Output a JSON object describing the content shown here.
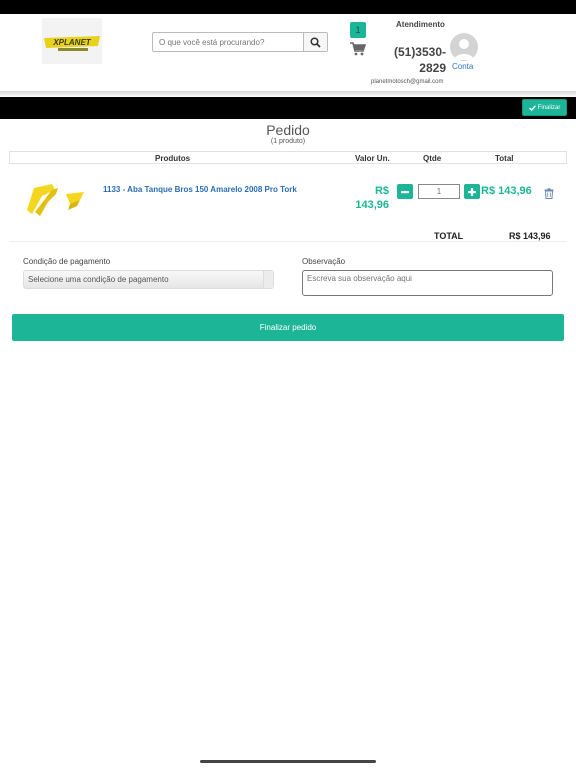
{
  "header": {
    "logo_text": "XPLANET",
    "search_placeholder": "O que você está procurando?",
    "cart_count": "1",
    "attendance_label": "Atendimento",
    "phone_line1": "(51)3530-",
    "phone_line2": "2829",
    "account_label": "Conta",
    "email": "planetmotosch@gmail.com",
    "finalize_top_label": "Finalizar"
  },
  "order": {
    "title": "Pedido",
    "subtitle": "(1 produto)",
    "columns": [
      "Produtos",
      "Valor Un.",
      "Qtde",
      "Total"
    ],
    "items": [
      {
        "name": "1133 - Aba Tanque Bros 150 Amarelo 2008 Pro Tork",
        "unit_price_line1": "R$",
        "unit_price_line2": "143,96",
        "quantity": "1",
        "total": "R$ 143,96"
      }
    ],
    "total_label": "TOTAL",
    "total_value": "R$ 143,96"
  },
  "payment": {
    "label": "Condição de pagamento",
    "selected": "Selecione uma condição de pagamento"
  },
  "observation": {
    "label": "Observação",
    "placeholder": "Escreva sua observação aqui"
  },
  "actions": {
    "finalize_order_label": "Finalizar pedido"
  },
  "colors": {
    "accent": "#1db597",
    "link": "#2a6db5"
  }
}
